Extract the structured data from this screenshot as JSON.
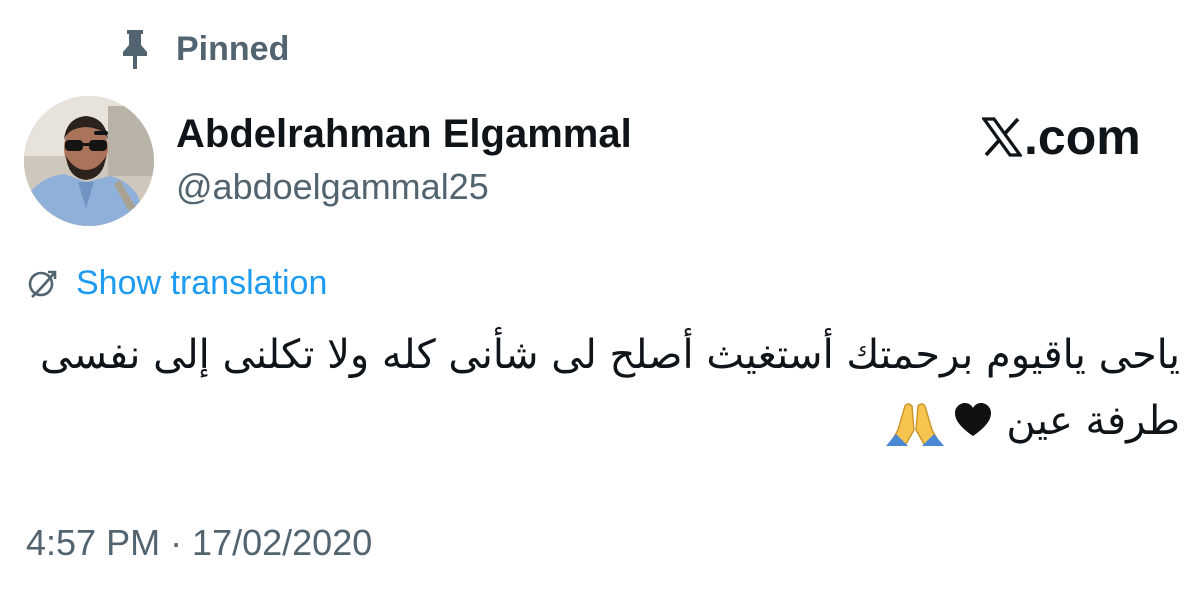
{
  "pinned": {
    "label": "Pinned",
    "icon": "pin-icon"
  },
  "author": {
    "display_name": "Abdelrahman Elgammal",
    "handle": "@abdoelgammal25",
    "avatar_icon": "profile-photo"
  },
  "brand": {
    "icon": "x-logo-icon",
    "suffix": ".com"
  },
  "translation": {
    "icon": "globe-icon",
    "label": "Show translation"
  },
  "tweet": {
    "text": "ياحى ياقيوم برحمتك أستغيث أصلح لى شأنى كله ولا تكلنى إلى نفسى طرفة عين",
    "emojis": [
      "black-heart-icon",
      "folded-hands-icon"
    ]
  },
  "timestamp": "4:57 PM · 17/02/2020",
  "colors": {
    "text": "#0f1419",
    "secondary": "#536471",
    "link": "#1d9bf0",
    "background": "#ffffff"
  }
}
